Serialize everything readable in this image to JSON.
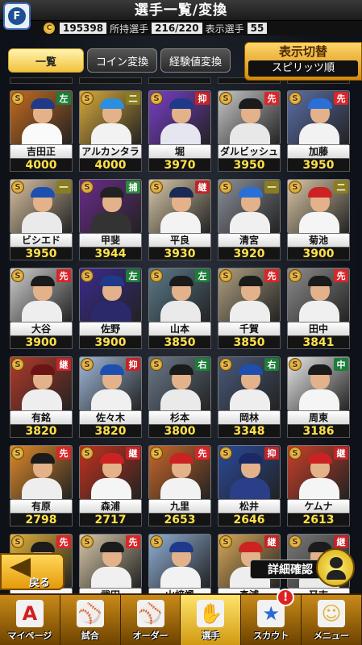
{
  "header": {
    "title": "選手一覧/変換",
    "team_badge": "F"
  },
  "stats": {
    "coins": "195398",
    "owned_label": "所持選手",
    "owned_value": "216/220",
    "display_label": "表示選手",
    "display_value": "55"
  },
  "tabs": [
    {
      "label": "一覧"
    },
    {
      "label": "コイン変換"
    },
    {
      "label": "経験値変換"
    }
  ],
  "display_toggle": {
    "label": "表示切替",
    "sort": "スピリッツ順"
  },
  "rows": [
    [
      {
        "name": "吉田正",
        "value": "4000",
        "pos": "左",
        "cls": "sa",
        "bg": "#c56b1f",
        "cap": "#1f3a8a",
        "body": "#fafafa"
      },
      {
        "name": "アルカンタラ",
        "value": "4000",
        "pos": "二",
        "cls": "ni",
        "bg": "#d8aa3b",
        "cap": "#2a8fe0",
        "body": "#f2f2f2"
      },
      {
        "name": "堀",
        "value": "3970",
        "pos": "抑",
        "cls": "yok",
        "bg": "#7a3ec9",
        "cap": "#1f3a8a",
        "body": "#e6e6f0"
      },
      {
        "name": "ダルビッシュ",
        "value": "3950",
        "pos": "先",
        "cls": "sen",
        "bg": "#c7c7c7",
        "cap": "#1b1b1b",
        "body": "#e8e8e8"
      },
      {
        "name": "加藤",
        "value": "3950",
        "pos": "先",
        "cls": "sen",
        "bg": "#5b6fa8",
        "cap": "#2a6fd8",
        "body": "#f2f2f2"
      }
    ],
    [
      {
        "name": "ビシエド",
        "value": "3950",
        "pos": "一",
        "cls": "ichi",
        "bg": "#d9c2a1",
        "cap": "#1d4fb0",
        "body": "#eaeaea"
      },
      {
        "name": "甲斐",
        "value": "3944",
        "pos": "捕",
        "cls": "hosaku",
        "bg": "#6b2b8a",
        "cap": "#222",
        "body": "#333"
      },
      {
        "name": "平良",
        "value": "3930",
        "pos": "継",
        "cls": "kei",
        "bg": "#d8c8a8",
        "cap": "#1a2a55",
        "body": "#f3f3f3"
      },
      {
        "name": "清宮",
        "value": "3920",
        "pos": "一",
        "cls": "ichi",
        "bg": "#8a8f99",
        "cap": "#2a6fd8",
        "body": "#f0f0f0"
      },
      {
        "name": "菊池",
        "value": "3900",
        "pos": "二",
        "cls": "ni",
        "bg": "#d9c6a5",
        "cap": "#cc2222",
        "body": "#f5f5f5"
      }
    ],
    [
      {
        "name": "大谷",
        "value": "3900",
        "pos": "先",
        "cls": "sen",
        "bg": "#cfcfcf",
        "cap": "#1b1b1b",
        "body": "#eeeeee"
      },
      {
        "name": "佐野",
        "value": "3900",
        "pos": "左",
        "cls": "sa",
        "bg": "#3b2a8e",
        "cap": "#1f3a8a",
        "body": "#2a2a6a"
      },
      {
        "name": "山本",
        "value": "3850",
        "pos": "左",
        "cls": "sa",
        "bg": "#5a7b8a",
        "cap": "#1b1b1b",
        "body": "#eaeaea"
      },
      {
        "name": "千賀",
        "value": "3850",
        "pos": "先",
        "cls": "sen",
        "bg": "#b0a080",
        "cap": "#1b1b1b",
        "body": "#eeeeee"
      },
      {
        "name": "田中",
        "value": "3841",
        "pos": "先",
        "cls": "sen",
        "bg": "#8c8c8c",
        "cap": "#1b1b1b",
        "body": "#f0f0f0"
      }
    ],
    [
      {
        "name": "有銘",
        "value": "3820",
        "pos": "継",
        "cls": "kei",
        "bg": "#b33a2a",
        "cap": "#6b1414",
        "body": "#eeeeee"
      },
      {
        "name": "佐々木",
        "value": "3820",
        "pos": "抑",
        "cls": "yok",
        "bg": "#9fb8d8",
        "cap": "#1d4fb0",
        "body": "#f0f0f0"
      },
      {
        "name": "杉本",
        "value": "3800",
        "pos": "右",
        "cls": "yu",
        "bg": "#6a7a8a",
        "cap": "#1b1b1b",
        "body": "#eaeaea"
      },
      {
        "name": "岡林",
        "value": "3348",
        "pos": "右",
        "cls": "yu",
        "bg": "#4a5a7a",
        "cap": "#1d4fb0",
        "body": "#eeeeee"
      },
      {
        "name": "周東",
        "value": "3186",
        "pos": "中",
        "cls": "chu",
        "bg": "#e8e8e8",
        "cap": "#1b1b1b",
        "body": "#f5f5f5"
      }
    ],
    [
      {
        "name": "有原",
        "value": "2798",
        "pos": "先",
        "cls": "sen",
        "bg": "#e08a2a",
        "cap": "#1b1b1b",
        "body": "#eeeeee"
      },
      {
        "name": "森浦",
        "value": "2717",
        "pos": "継",
        "cls": "kei",
        "bg": "#c2331f",
        "cap": "#cc2222",
        "body": "#f5f5f5"
      },
      {
        "name": "九里",
        "value": "2653",
        "pos": "先",
        "cls": "sen",
        "bg": "#c9682a",
        "cap": "#cc2222",
        "body": "#f2f2f2"
      },
      {
        "name": "松井",
        "value": "2646",
        "pos": "抑",
        "cls": "yok",
        "bg": "#2a4a9a",
        "cap": "#1b2a66",
        "body": "#2a3f88"
      },
      {
        "name": "ケムナ",
        "value": "2613",
        "pos": "継",
        "cls": "kei",
        "bg": "#c9402a",
        "cap": "#cc2222",
        "body": "#f5f5f5"
      }
    ],
    [
      {
        "name": "",
        "value": "",
        "pos": "先",
        "cls": "sen",
        "bg": "#e2b23a",
        "cap": "#1b1b1b",
        "body": "#eeeeee"
      },
      {
        "name": "武田",
        "value": "",
        "pos": "先",
        "cls": "sen",
        "bg": "#d8c8a8",
        "cap": "#1b1b1b",
        "body": "#f0f0f0"
      },
      {
        "name": "山﨑颯",
        "value": "",
        "pos": "",
        "cls": "sen",
        "bg": "#8fb0d8",
        "cap": "#1f3a8a",
        "body": "#f2f2f2"
      },
      {
        "name": "森浦",
        "value": "",
        "pos": "継",
        "cls": "kei",
        "bg": "#d8a85a",
        "cap": "#cc2222",
        "body": "#eeeeee"
      },
      {
        "name": "又吉",
        "value": "",
        "pos": "継",
        "cls": "kei",
        "bg": "#7a7a7a",
        "cap": "#1b1b1b",
        "body": "#eaeaea"
      }
    ]
  ],
  "back_button": {
    "label": "戻る"
  },
  "detail_button": {
    "label": "詳細確認"
  },
  "bottom_nav": [
    {
      "label": "マイページ",
      "icon": "A",
      "color": "#d02020"
    },
    {
      "label": "試合",
      "icon": "⚾",
      "color": "#444"
    },
    {
      "label": "オーダー",
      "icon": "⚾",
      "color": "#2a7a3a"
    },
    {
      "label": "選手",
      "icon": "✋",
      "color": "#2a9a3a"
    },
    {
      "label": "スカウト",
      "icon": "★",
      "color": "#2a6ad8"
    },
    {
      "label": "メニュー",
      "icon": "☺",
      "color": "#e2b23a"
    }
  ],
  "scout_notification": "!"
}
